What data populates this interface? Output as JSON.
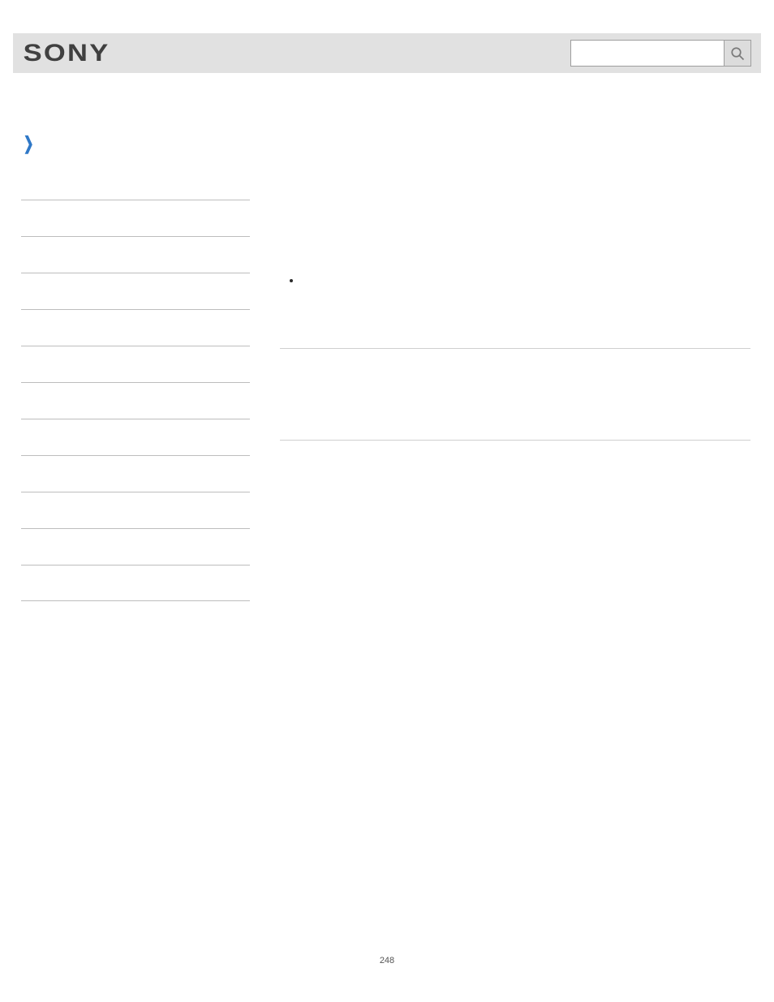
{
  "header": {
    "logo_text": "SONY",
    "search_placeholder": ""
  },
  "sidebar": {
    "items": [
      {
        "label": ""
      },
      {
        "label": ""
      },
      {
        "label": ""
      },
      {
        "label": ""
      },
      {
        "label": ""
      },
      {
        "label": ""
      },
      {
        "label": ""
      },
      {
        "label": ""
      },
      {
        "label": ""
      },
      {
        "label": ""
      },
      {
        "label": ""
      }
    ]
  },
  "page_number": "248"
}
